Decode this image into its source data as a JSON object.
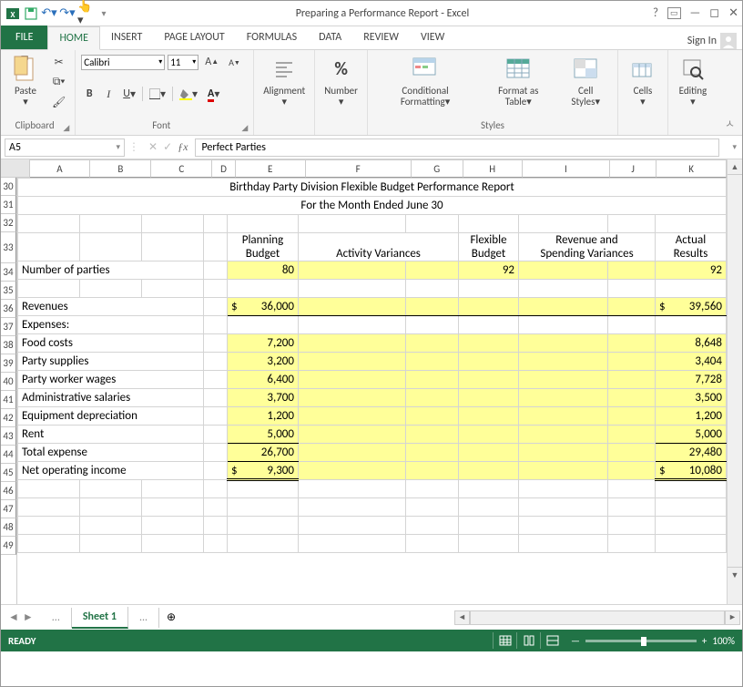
{
  "titlebar": {
    "title": "Preparing a Performance Report - Excel"
  },
  "tabs": {
    "file": "FILE",
    "home": "HOME",
    "insert": "INSERT",
    "pagelayout": "PAGE LAYOUT",
    "formulas": "FORMULAS",
    "data": "DATA",
    "review": "REVIEW",
    "view": "VIEW",
    "signin": "Sign In"
  },
  "ribbon": {
    "paste": "Paste",
    "clipboard_group": "Clipboard",
    "font_group": "Font",
    "font_name": "Calibri",
    "font_size": "11",
    "bold": "B",
    "italic": "I",
    "underline": "U",
    "alignment": "Alignment",
    "number": "Number",
    "conditional": "Conditional Formatting",
    "formatas": "Format as Table",
    "cellstyles": "Cell Styles",
    "styles_group": "Styles",
    "cells": "Cells",
    "editing": "Editing",
    "percent": "%"
  },
  "fx": {
    "cellref": "A5",
    "formula": "Perfect Parties"
  },
  "columns": [
    "A",
    "B",
    "C",
    "D",
    "E",
    "F",
    "G",
    "H",
    "I",
    "J",
    "K"
  ],
  "rows": [
    "30",
    "31",
    "32",
    "33",
    "34",
    "35",
    "36",
    "37",
    "38",
    "39",
    "40",
    "41",
    "42",
    "43",
    "44",
    "45",
    "46",
    "47",
    "48",
    "49"
  ],
  "grid": {
    "r30_title": "Birthday Party Division Flexible Budget Performance Report",
    "r31_sub": "For the Month Ended June 30",
    "r33_planning1": "Planning",
    "r33_planning2": "Budget",
    "r33_activity": "Activity Variances",
    "r33_flex1": "Flexible",
    "r33_flex2": "Budget",
    "r33_rev1": "Revenue and",
    "r33_rev2": "Spending Variances",
    "r33_actual1": "Actual",
    "r33_actual2": "Results",
    "r34_label": "Number of parties",
    "r34_e": "80",
    "r34_h": "92",
    "r34_k": "92",
    "r36_label": "Revenues",
    "r36_e_cur": "$",
    "r36_e": "36,000",
    "r36_k_cur": "$",
    "r36_k": "39,560",
    "r37_label": "Expenses:",
    "r38_label": " Food costs",
    "r38_e": "7,200",
    "r38_k": "8,648",
    "r39_label": " Party supplies",
    "r39_e": "3,200",
    "r39_k": "3,404",
    "r40_label": " Party worker wages",
    "r40_e": "6,400",
    "r40_k": "7,728",
    "r41_label": " Administrative salaries",
    "r41_e": "3,700",
    "r41_k": "3,500",
    "r42_label": " Equipment depreciation",
    "r42_e": "1,200",
    "r42_k": "1,200",
    "r43_label": " Rent",
    "r43_e": "5,000",
    "r43_k": "5,000",
    "r44_label": "Total expense",
    "r44_e": "26,700",
    "r44_k": "29,480",
    "r45_label": "Net operating income",
    "r45_e_cur": "$",
    "r45_e": "9,300",
    "r45_k_cur": "$",
    "r45_k": "10,080"
  },
  "sheets": {
    "dots": "...",
    "sheet1": "Sheet 1"
  },
  "status": {
    "ready": "READY",
    "zoom": "100%"
  }
}
